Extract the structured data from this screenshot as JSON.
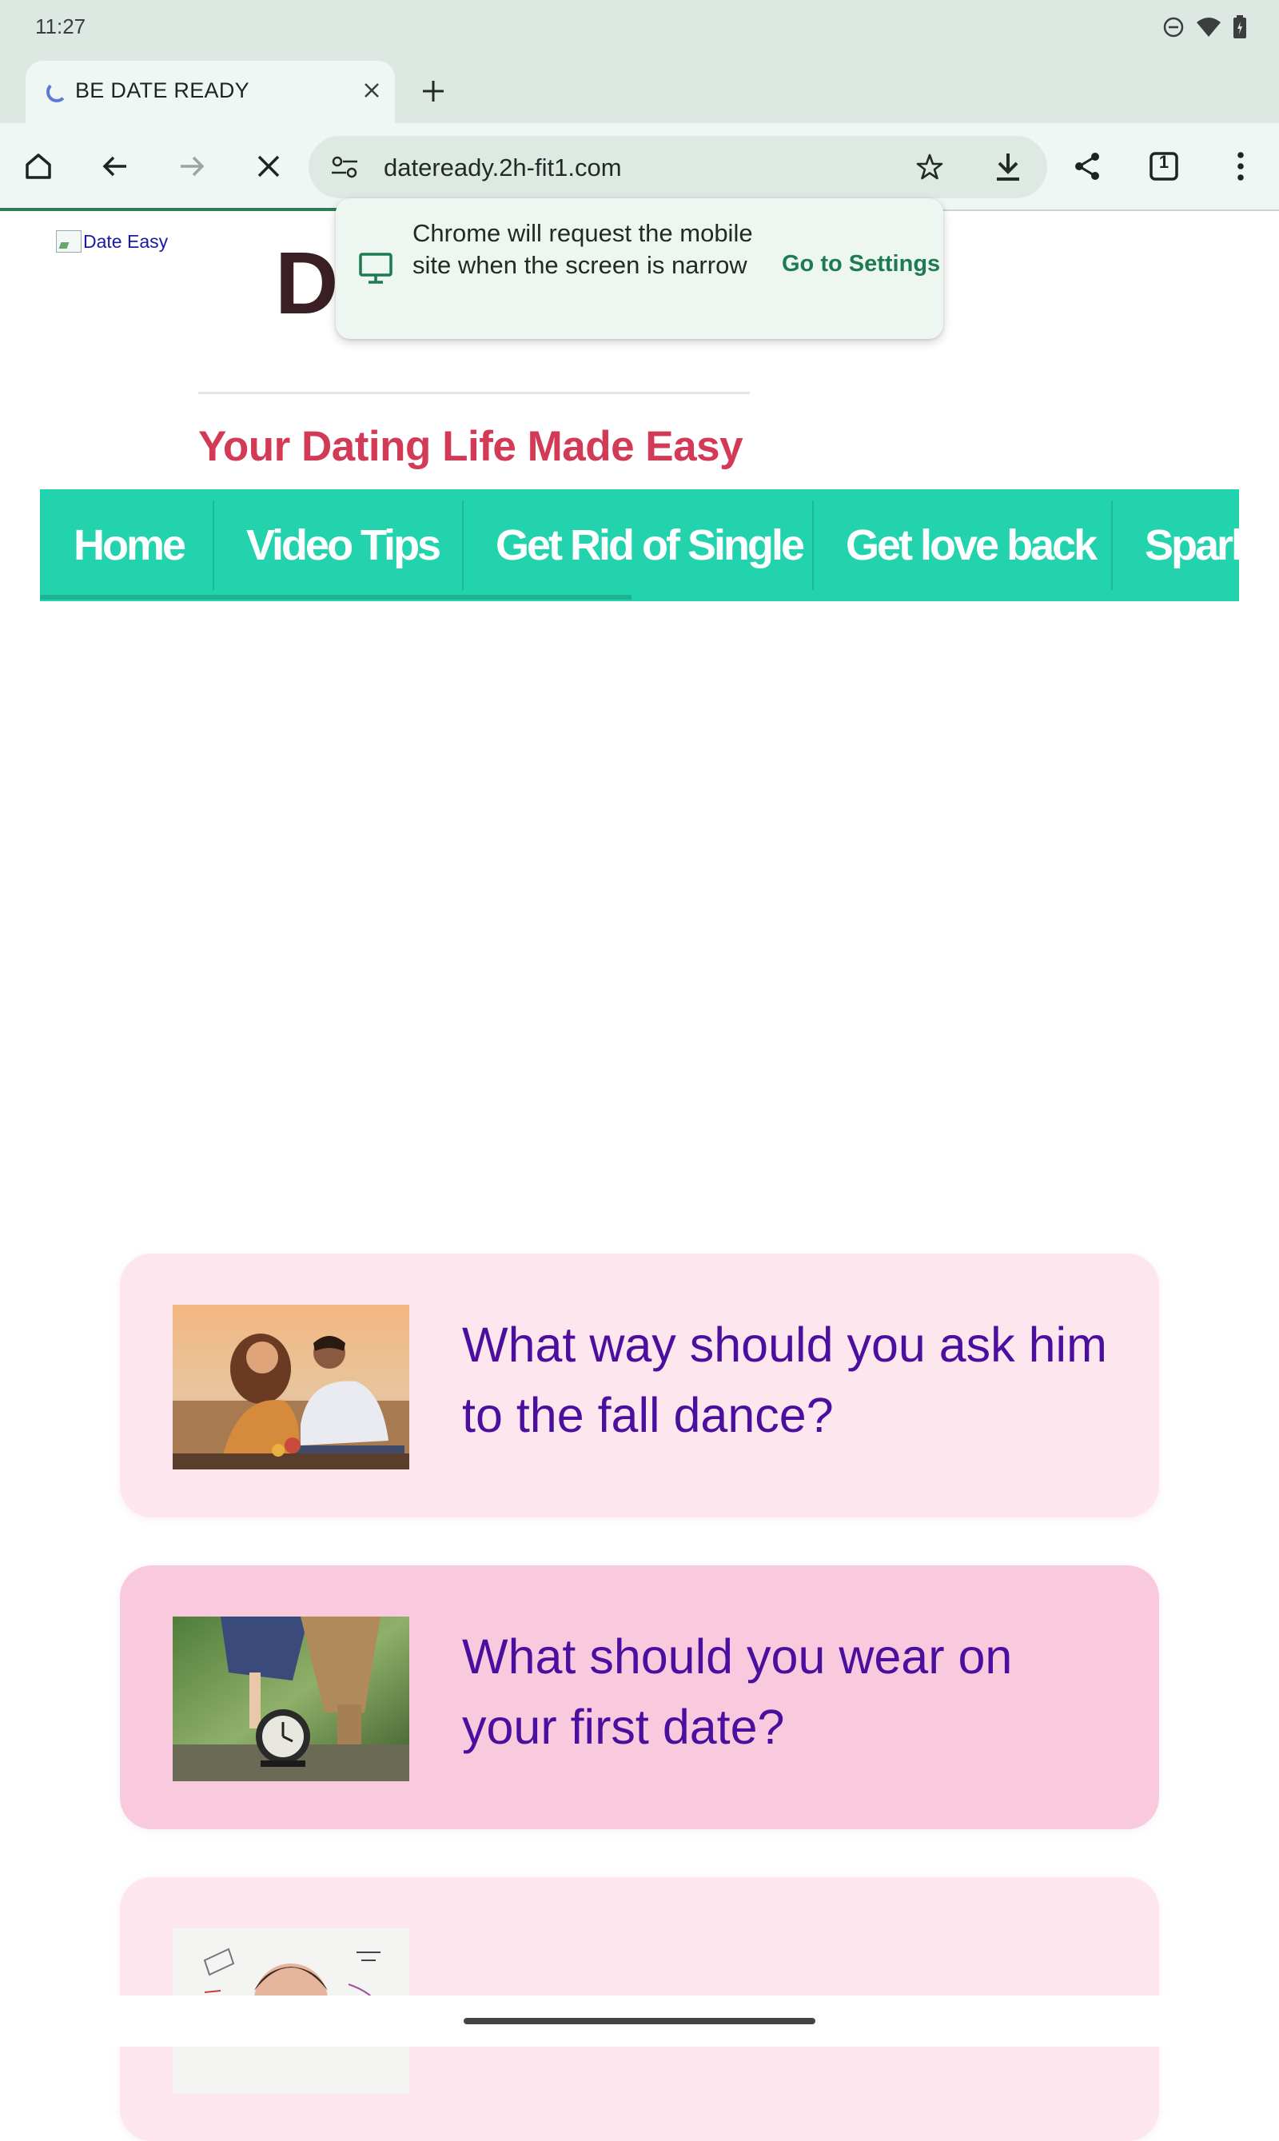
{
  "status_bar": {
    "time": "11:27"
  },
  "tab": {
    "title": "BE DATE READY"
  },
  "toolbar": {
    "url": "dateready.2h-fit1.com",
    "tab_count": "1"
  },
  "popup": {
    "message": "Chrome will request the mobile site when the screen is narrow",
    "action": "Go to Settings"
  },
  "site": {
    "logo_alt": "Date Easy",
    "title_partial": "D",
    "tagline": "Your Dating Life Made Easy"
  },
  "nav": {
    "items": [
      "Home",
      "Video Tips",
      "Get Rid of Single",
      "Get love back",
      "Spark"
    ]
  },
  "articles": [
    {
      "title": "What way should you ask him to the fall dance?"
    },
    {
      "title": "What should you wear on your first date?"
    }
  ],
  "colors": {
    "nav_bg": "#22d3ae",
    "tagline": "#d23a56",
    "article_title": "#4b0fa0",
    "card_light": "#fde6ee",
    "card_pink": "#f9cadd",
    "chrome_accent": "#1e7a50"
  },
  "icons": {
    "status": [
      "do-not-disturb-icon",
      "wifi-icon",
      "battery-icon"
    ],
    "toolbar": [
      "home-icon",
      "back-icon",
      "forward-icon",
      "stop-icon",
      "site-settings-icon",
      "bookmark-star-icon",
      "download-icon",
      "share-icon",
      "tab-switcher-icon",
      "more-menu-icon"
    ]
  },
  "loading_progress": 0.47
}
